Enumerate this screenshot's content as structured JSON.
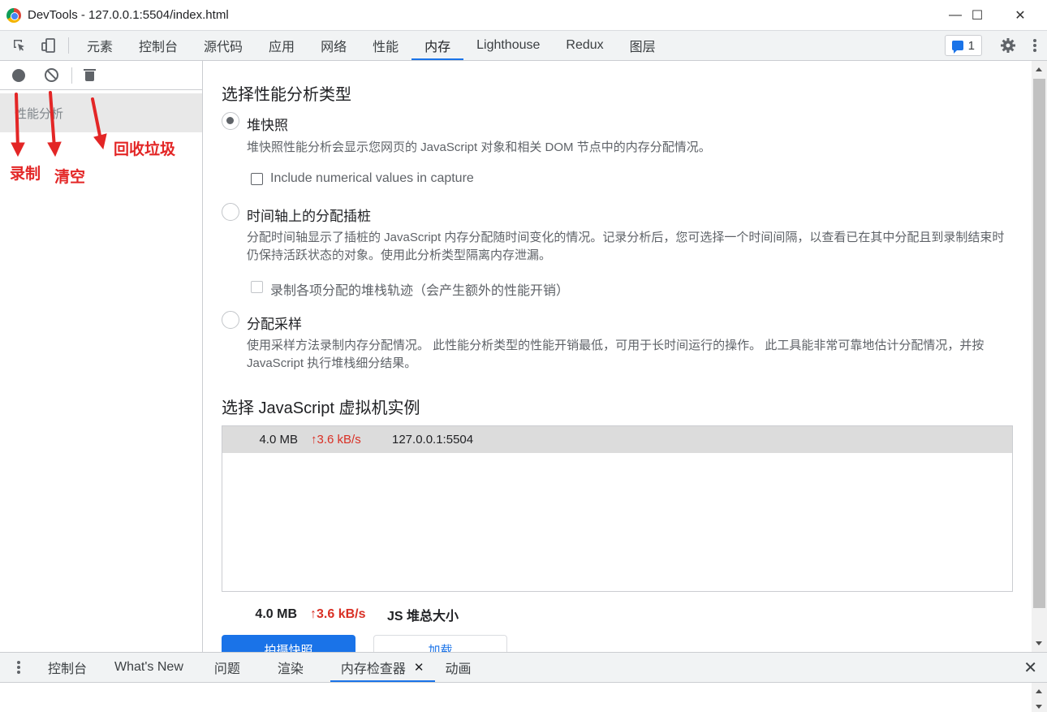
{
  "window": {
    "title": "DevTools - 127.0.0.1:5504/index.html",
    "minimize": "—",
    "maximize": "☐",
    "close": "✕"
  },
  "toolbar": {
    "tabs": [
      {
        "label": "元素"
      },
      {
        "label": "控制台"
      },
      {
        "label": "源代码"
      },
      {
        "label": "应用"
      },
      {
        "label": "网络"
      },
      {
        "label": "性能"
      },
      {
        "label": "内存"
      },
      {
        "label": "Lighthouse"
      },
      {
        "label": "Redux"
      },
      {
        "label": "图层"
      }
    ],
    "active_tab": "内存",
    "issues_count": "1"
  },
  "sidebar": {
    "item_label": "性能分析"
  },
  "annotations": {
    "record": "录制",
    "clear": "清空",
    "gc": "回收垃圾",
    "color": "#e32626"
  },
  "profile_types": {
    "heading": "选择性能分析类型",
    "heap_snapshot": {
      "label": "堆快照",
      "desc": "堆快照性能分析会显示您网页的 JavaScript 对象和相关 DOM 节点中的内存分配情况。",
      "option": "Include numerical values in capture",
      "selected": true
    },
    "allocation_timeline": {
      "label": "时间轴上的分配插桩",
      "desc": "分配时间轴显示了插桩的 JavaScript 内存分配随时间变化的情况。记录分析后，您可选择一个时间间隔，以查看已在其中分配且到录制结束时仍保持活跃状态的对象。使用此分析类型隔离内存泄漏。",
      "option": "录制各项分配的堆栈轨迹（会产生额外的性能开销）"
    },
    "allocation_sampling": {
      "label": "分配采样",
      "desc": "使用采样方法录制内存分配情况。 此性能分析类型的性能开销最低，可用于长时间运行的操作。 此工具能非常可靠地估计分配情况，并按 JavaScript 执行堆栈细分结果。"
    }
  },
  "vm": {
    "heading": "选择 JavaScript 虚拟机实例",
    "instance": {
      "size": "4.0 MB",
      "rate": "↑3.6 kB/s",
      "url": "127.0.0.1:5504"
    }
  },
  "totals": {
    "size": "4.0 MB",
    "rate": "↑3.6 kB/s",
    "label": "JS 堆总大小"
  },
  "buttons": {
    "take_snapshot": "拍摄快照",
    "load": "加载"
  },
  "drawer": {
    "tabs": [
      {
        "label": "控制台"
      },
      {
        "label": "What's New"
      },
      {
        "label": "问题"
      },
      {
        "label": "渲染"
      },
      {
        "label": "内存检查器"
      },
      {
        "label": "动画"
      }
    ],
    "active_tab": "内存检查器",
    "close_glyph": "✕",
    "tab_close_glyph": "✕"
  },
  "colors": {
    "accent": "#1a73e8",
    "rate": "#d93025"
  }
}
